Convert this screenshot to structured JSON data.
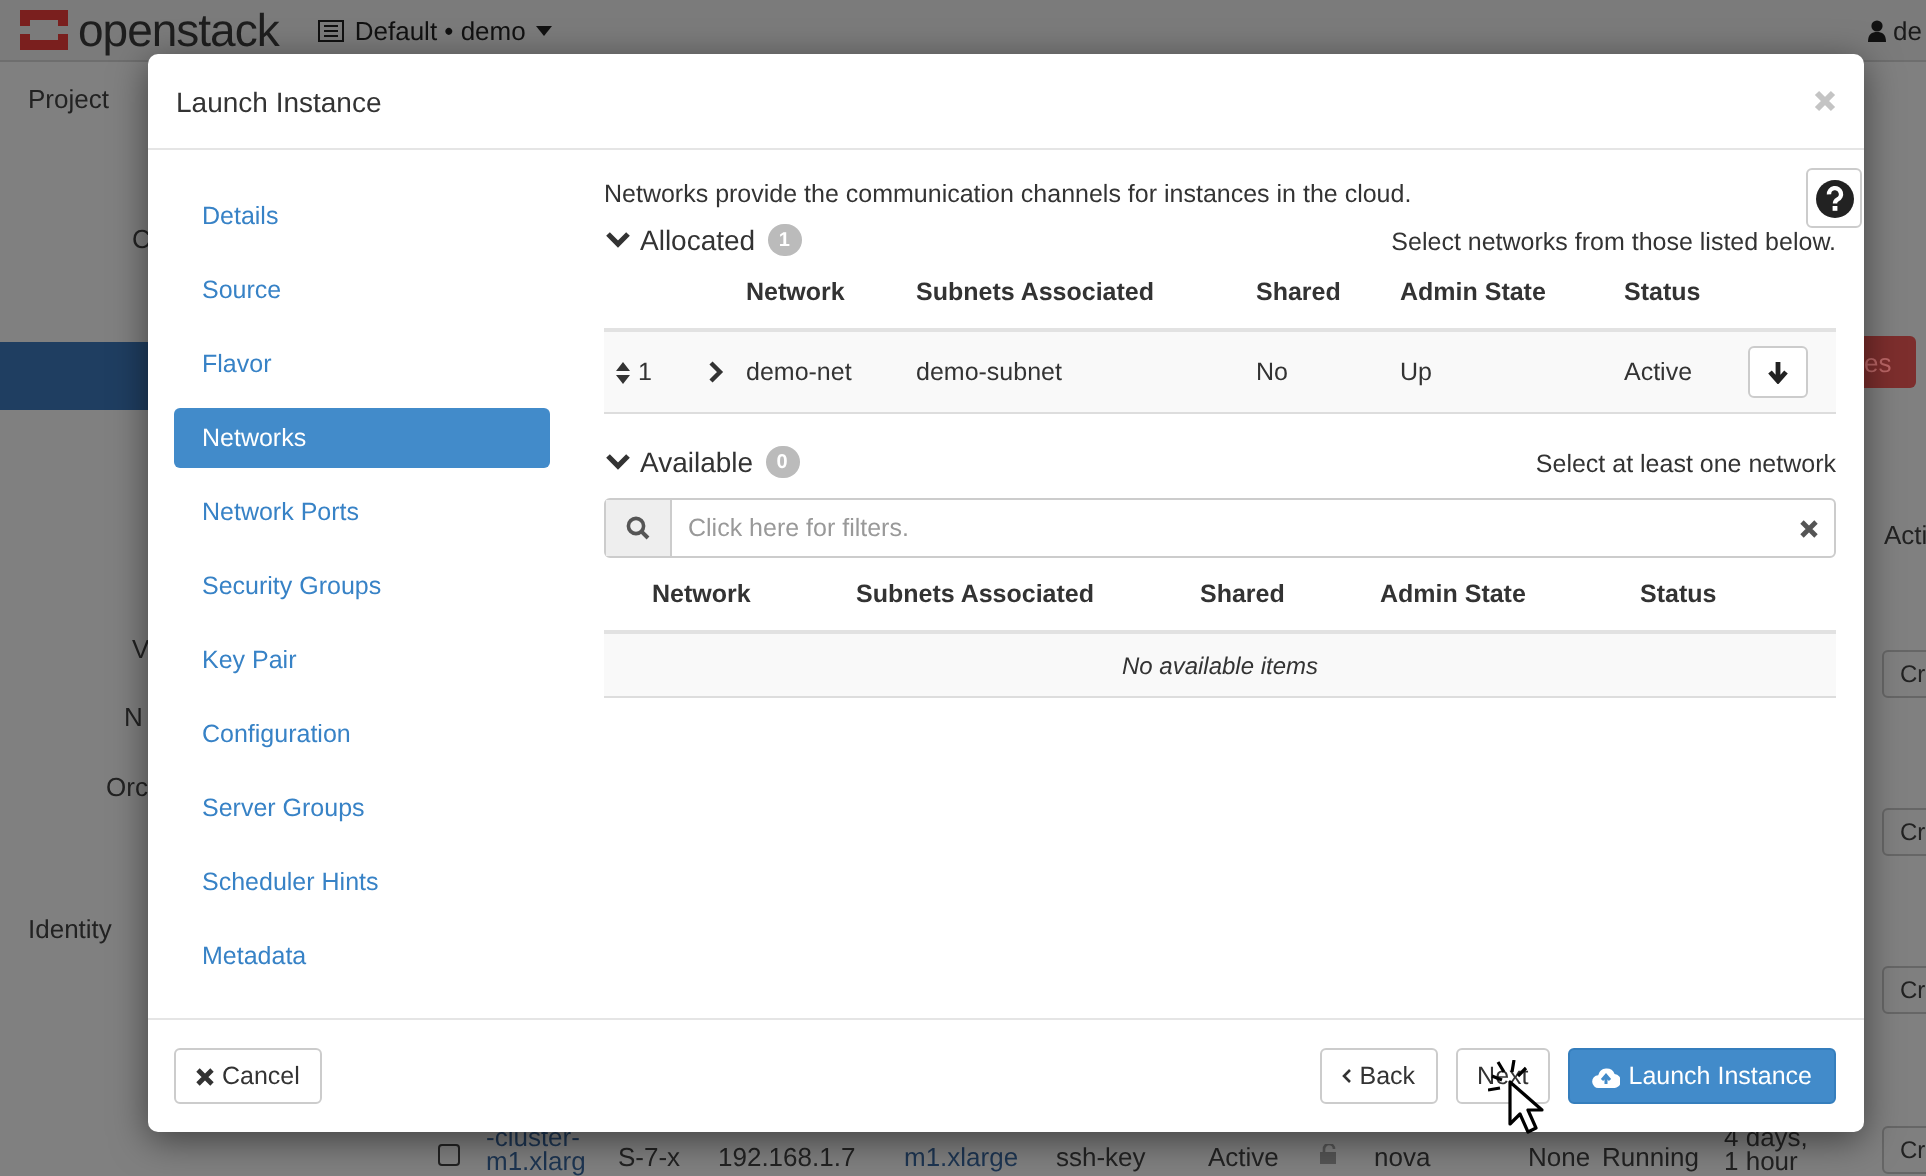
{
  "backdrop": {
    "brand": "openstack",
    "project_selector": "Default • demo",
    "user": "de",
    "top_nav": "Project",
    "side_fragments": [
      "C",
      "V",
      "N",
      "Orc"
    ],
    "side_section": "Identity",
    "red_button": "es",
    "column_heading": "Acti",
    "row_buttons": [
      "Cr",
      "Cr",
      "Cr",
      "Cr"
    ],
    "bottom_row": {
      "checked": false,
      "name_lines": [
        "-cluster-",
        "m1.xlarg"
      ],
      "image": "S-7-x",
      "ip": "192.168.1.7",
      "flavor": "m1.xlarge",
      "key_pair": "ssh-key",
      "status": "Active",
      "zone": "nova",
      "task": "None",
      "power": "Running",
      "age_lines": [
        "4 days,",
        "1 hour"
      ]
    }
  },
  "modal": {
    "title": "Launch Instance",
    "steps": [
      {
        "label": "Details",
        "selected": false
      },
      {
        "label": "Source",
        "selected": false
      },
      {
        "label": "Flavor",
        "selected": false
      },
      {
        "label": "Networks",
        "selected": true
      },
      {
        "label": "Network Ports",
        "selected": false
      },
      {
        "label": "Security Groups",
        "selected": false
      },
      {
        "label": "Key Pair",
        "selected": false
      },
      {
        "label": "Configuration",
        "selected": false
      },
      {
        "label": "Server Groups",
        "selected": false
      },
      {
        "label": "Scheduler Hints",
        "selected": false
      },
      {
        "label": "Metadata",
        "selected": false
      }
    ],
    "description": "Networks provide the communication channels for instances in the cloud.",
    "allocated": {
      "title": "Allocated",
      "count": "1",
      "hint": "Select networks from those listed below.",
      "columns": [
        "Network",
        "Subnets Associated",
        "Shared",
        "Admin State",
        "Status"
      ],
      "rows": [
        {
          "order": "1",
          "network": "demo-net",
          "subnets": "demo-subnet",
          "shared": "No",
          "admin_state": "Up",
          "status": "Active"
        }
      ]
    },
    "available": {
      "title": "Available",
      "count": "0",
      "hint": "Select at least one network",
      "filter_placeholder": "Click here for filters.",
      "columns": [
        "Network",
        "Subnets Associated",
        "Shared",
        "Admin State",
        "Status"
      ],
      "empty_message": "No available items"
    },
    "buttons": {
      "cancel": "Cancel",
      "back": "Back",
      "next": "Next",
      "launch": "Launch Instance"
    }
  }
}
